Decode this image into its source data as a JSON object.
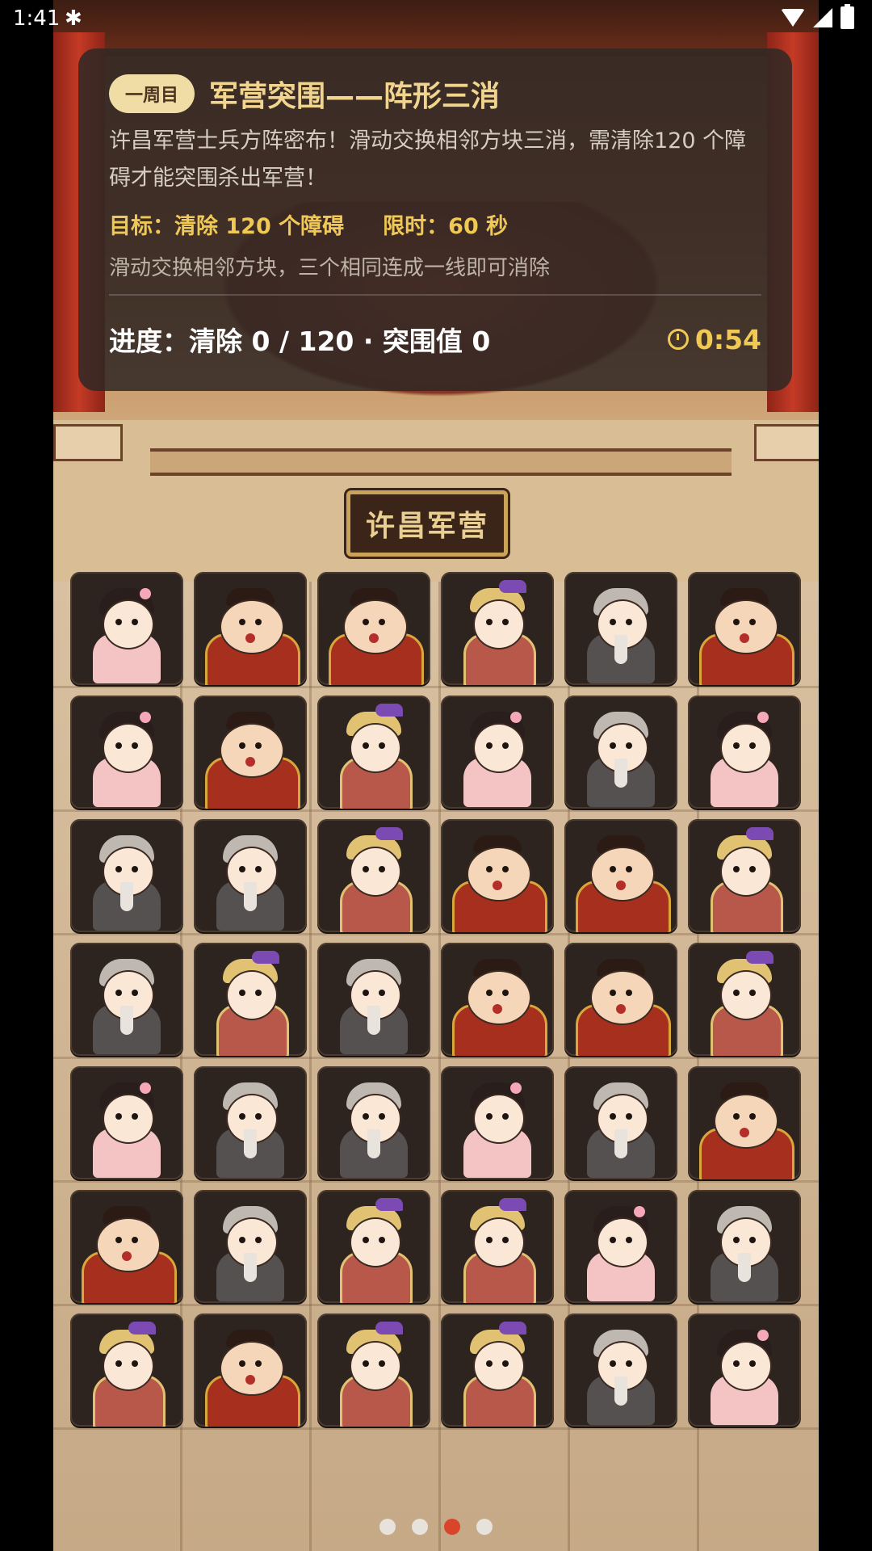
{
  "status_bar": {
    "time": "1:41",
    "app_icon": "bug-icon"
  },
  "panel": {
    "round_badge": "一周目",
    "title": "军营突围——阵形三消",
    "description": "许昌军营士兵方阵密布！滑动交换相邻方块三消，需清除120 个障碍才能突围杀出军营！",
    "goal": "目标：清除 120 个障碍",
    "time_limit": "限时：60 秒",
    "hint": "滑动交换相邻方块，三个相同连成一线即可消除",
    "progress": "进度：清除 0 / 120 · 突围值 0",
    "timer": "0:54"
  },
  "scene": {
    "camp_sign": "许昌军营"
  },
  "board": {
    "rows": [
      [
        "lady",
        "general",
        "general",
        "warrior",
        "sage",
        "general"
      ],
      [
        "lady",
        "general",
        "warrior",
        "lady",
        "sage",
        "lady"
      ],
      [
        "sage",
        "sage",
        "warrior",
        "general",
        "general",
        "warrior"
      ],
      [
        "sage",
        "warrior",
        "sage",
        "general",
        "general",
        "warrior"
      ],
      [
        "lady",
        "sage",
        "sage",
        "lady",
        "sage",
        "general"
      ],
      [
        "general",
        "sage",
        "warrior",
        "warrior",
        "lady",
        "sage"
      ],
      [
        "warrior",
        "general",
        "warrior",
        "warrior",
        "sage",
        "lady"
      ]
    ]
  },
  "pager": {
    "count": 4,
    "active_index": 2
  },
  "colors": {
    "accent": "#f0c955",
    "title": "#f1d58f",
    "tile_bg": "#2d2420",
    "active_dot": "#d8452c"
  }
}
